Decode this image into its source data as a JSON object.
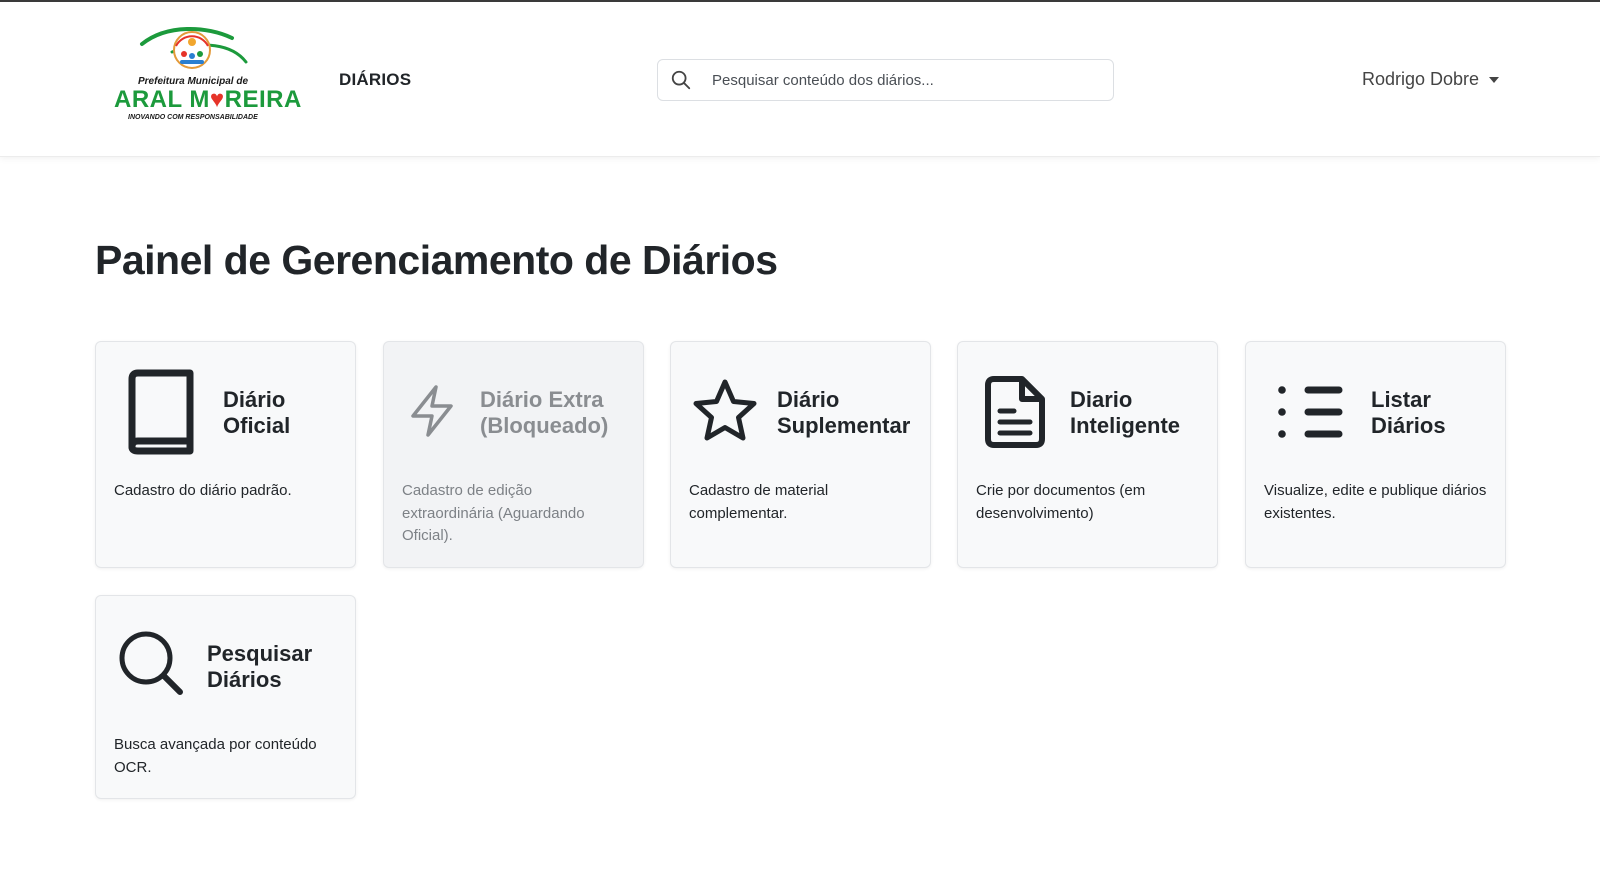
{
  "header": {
    "logo": {
      "line1": "Prefeitura Municipal de",
      "name_part1": "ARAL M",
      "heart": "♥",
      "name_part2": "REIRA",
      "motto": "INOVANDO COM RESPONSABILIDADE"
    },
    "nav_link": "DIÁRIOS",
    "search": {
      "placeholder": "Pesquisar conteúdo dos diários..."
    },
    "user": {
      "name": "Rodrigo Dobre"
    }
  },
  "page": {
    "title": "Painel de Gerenciamento de Diários"
  },
  "cards": [
    {
      "title1": "Diário",
      "title2": "Oficial",
      "desc": "Cadastro do diário padrão.",
      "icon": "book-icon",
      "disabled": false
    },
    {
      "title1": "Diário Extra",
      "title2": "(Bloqueado)",
      "desc": "Cadastro de edição extraordinária (Aguardando Oficial).",
      "icon": "lightning-icon",
      "disabled": true
    },
    {
      "title1": "Diário",
      "title2": "Suplementar",
      "desc": "Cadastro de material complementar.",
      "icon": "star-icon",
      "disabled": false
    },
    {
      "title1": "Diario",
      "title2": "Inteligente",
      "desc": "Crie por documentos (em desenvolvimento)",
      "icon": "document-icon",
      "disabled": false
    },
    {
      "title1": "Listar",
      "title2": "Diários",
      "desc": "Visualize, edite e publique diários existentes.",
      "icon": "list-icon",
      "disabled": false
    },
    {
      "title1": "Pesquisar",
      "title2": "Diários",
      "desc": "Busca avançada por conteúdo OCR.",
      "icon": "search-icon",
      "disabled": false
    }
  ],
  "colors": {
    "brand_green": "#1c9a3c",
    "brand_red": "#e63329",
    "card_bg": "#f8f9fa",
    "text_dark": "#212529",
    "text_muted": "#8a8d91"
  }
}
